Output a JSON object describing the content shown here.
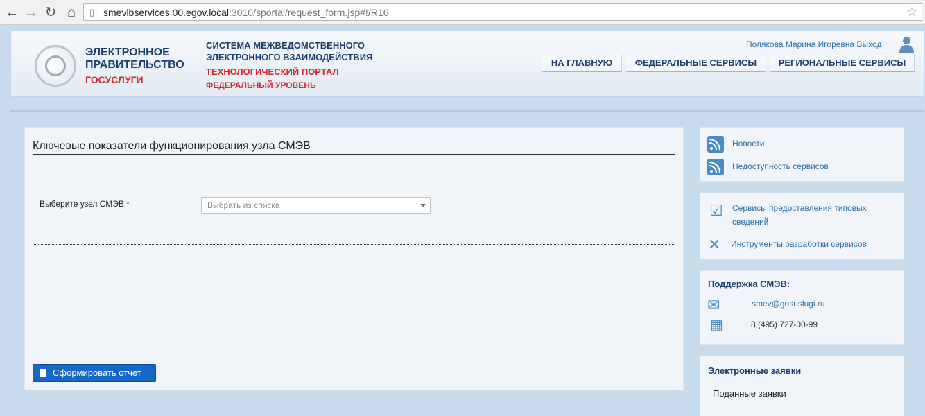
{
  "browser": {
    "url_host": "smevlbservices.00.egov.local",
    "url_path": ":3010/sportal/request_form.jsp#!/R16"
  },
  "header": {
    "logo_line1": "ЭЛЕКТРОННОЕ",
    "logo_line2": "ПРАВИТЕЛЬСТВО",
    "logo_line3": "ГОСУСЛУГИ",
    "system_line1": "СИСТЕМА МЕЖВЕДОМСТВЕННОГО",
    "system_line2": "ЭЛЕКТРОННОГО ВЗАИМОДЕЙСТВИЯ",
    "portal": "ТЕХНОЛОГИЧЕСКИЙ ПОРТАЛ",
    "level": "ФЕДЕРАЛЬНЫЙ УРОВЕНЬ",
    "user_name": "Полякова Марина Игоревна",
    "logout": "Выход",
    "nav": [
      "НА ГЛАВНУЮ",
      "ФЕДЕРАЛЬНЫЕ СЕРВИСЫ",
      "РЕГИОНАЛЬНЫЕ СЕРВИСЫ"
    ]
  },
  "main": {
    "title": "Ключевые показатели функционирования узла СМЭВ",
    "field_label": "Выберите узел СМЭВ",
    "required_mark": "*",
    "select_placeholder": "Выбрать из списка",
    "submit_label": "Сформировать отчет"
  },
  "sidebar": {
    "news": "Новости",
    "unavailability": "Недоступность сервисов",
    "typical_services_1": "Сервисы предоставления типовых",
    "typical_services_2": "сведений",
    "dev_tools": "Инструменты разработки сервисов",
    "support_title": "Поддержка СМЭВ:",
    "support_email": "smev@gosuslugi.ru",
    "support_phone": "8 (495) 727-00-99",
    "requests_title": "Электронные заявки",
    "submitted_requests": "Поданные заявки"
  }
}
